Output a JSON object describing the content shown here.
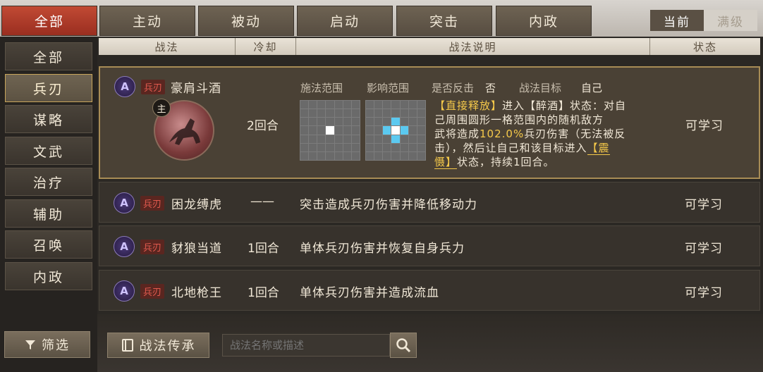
{
  "top_tabs": [
    {
      "label": "全部",
      "active": true
    },
    {
      "label": "主动",
      "active": false
    },
    {
      "label": "被动",
      "active": false
    },
    {
      "label": "启动",
      "active": false
    },
    {
      "label": "突击",
      "active": false
    },
    {
      "label": "内政",
      "active": false
    }
  ],
  "level_toggle": {
    "current": "当前",
    "max": "满级"
  },
  "sidebar": [
    {
      "label": "全部",
      "active": false
    },
    {
      "label": "兵刃",
      "active": true
    },
    {
      "label": "谋略",
      "active": false
    },
    {
      "label": "文武",
      "active": false
    },
    {
      "label": "治疗",
      "active": false
    },
    {
      "label": "辅助",
      "active": false
    },
    {
      "label": "召唤",
      "active": false
    },
    {
      "label": "内政",
      "active": false
    }
  ],
  "columns": {
    "skill": "战法",
    "cooldown": "冷却",
    "desc": "战法说明",
    "status": "状态"
  },
  "selected": {
    "grade": "A",
    "type": "兵刃",
    "name": "豪肩斗酒",
    "avatar_badge": "主",
    "cooldown": "2回合",
    "cast_range_label": "施法范围",
    "effect_range_label": "影响范围",
    "counter_label": "是否反击",
    "counter_value": "否",
    "target_label": "战法目标",
    "target_value": "自己",
    "desc_line1a": "【直接释放】",
    "desc_line1b": "进入【醉酒】状态：对自",
    "desc_line2": "己周围圆形一格范围内的随机敌方",
    "desc_line3a": "武将造成",
    "desc_line3b": "102.0%",
    "desc_line3c": "兵刃伤害（无法被反",
    "desc_line4a": "击），然后让自己和该目标进入",
    "desc_line4b": "【震",
    "desc_line5a": "慑】",
    "desc_line5b": "状态，持续1回合。",
    "status": "可学习"
  },
  "rows": [
    {
      "grade": "A",
      "type": "兵刃",
      "name": "困龙缚虎",
      "cooldown": "——",
      "desc": "突击造成兵刃伤害并降低移动力",
      "status": "可学习"
    },
    {
      "grade": "A",
      "type": "兵刃",
      "name": "豺狼当道",
      "cooldown": "1回合",
      "desc": "单体兵刃伤害并恢复自身兵力",
      "status": "可学习"
    },
    {
      "grade": "A",
      "type": "兵刃",
      "name": "北地枪王",
      "cooldown": "1回合",
      "desc": "单体兵刃伤害并造成流血",
      "status": "可学习"
    }
  ],
  "bottom": {
    "filter": "筛选",
    "inherit": "战法传承",
    "search_placeholder": "战法名称或描述"
  },
  "colors": {
    "accent_red": "#b33a28",
    "highlight_gold": "#f5c94a",
    "effect_blue": "#5bc9f0"
  }
}
